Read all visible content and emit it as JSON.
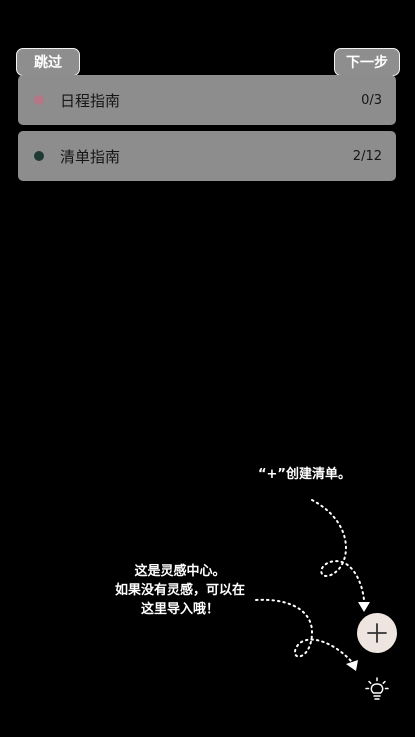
{
  "header": {
    "skip_label": "跳过",
    "next_label": "下一步"
  },
  "lists": [
    {
      "title": "日程指南",
      "count": "0/3",
      "dot_color": "#b57685"
    },
    {
      "title": "清单指南",
      "count": "2/12",
      "dot_color": "#1f3a33"
    }
  ],
  "hints": {
    "create_list": "“+”创建清单。",
    "inspiration_line1": "这是灵感中心。",
    "inspiration_line2": "如果没有灵感，可以在",
    "inspiration_line3": "这里导入哦！"
  },
  "icons": {
    "add": "plus-icon",
    "inspiration": "lightbulb-icon"
  },
  "colors": {
    "background": "#000000",
    "card": "#8d8d8d",
    "fab": "#efe5e0"
  }
}
